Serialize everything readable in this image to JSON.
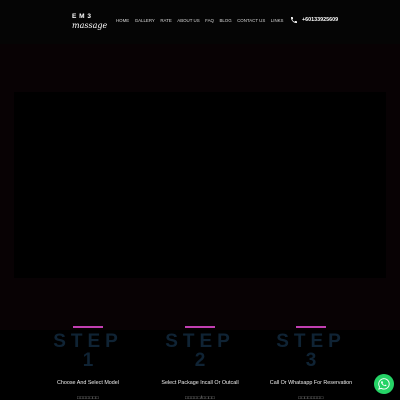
{
  "header": {
    "logo_top": "E M 3",
    "logo_bottom": "massage",
    "nav": [
      "HOME",
      "GALLERY",
      "RATE",
      "ABOUT US",
      "FAQ",
      "BLOG",
      "CONTACT US",
      "LINKS"
    ],
    "phone": "+60133925609",
    "phone_icon": "phone-icon"
  },
  "steps": [
    {
      "word": "STEP",
      "number": "1",
      "desc": "Choose And Select Model",
      "sub": "□□□□□□□"
    },
    {
      "word": "STEP",
      "number": "2",
      "desc": "Select Package Incall Or Outcall",
      "sub": "□□□□□/□□□□"
    },
    {
      "word": "STEP",
      "number": "3",
      "desc": "Call Or Whatsapp For Reservation",
      "sub": "□□□□□□□□"
    }
  ],
  "colors": {
    "accent": "#c23fb2",
    "step_text": "#0f2334",
    "whatsapp": "#25d366"
  },
  "floating": {
    "icon": "whatsapp-icon"
  }
}
